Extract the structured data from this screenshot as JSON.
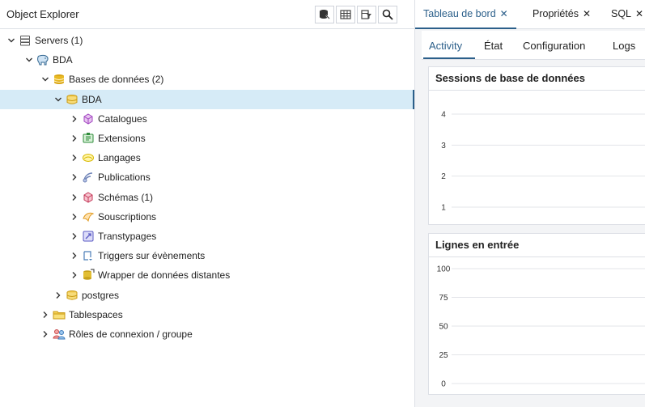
{
  "explorer": {
    "title": "Object Explorer",
    "toolbar": [
      {
        "name": "query-tool-icon"
      },
      {
        "name": "view-data-icon"
      },
      {
        "name": "filtered-rows-icon"
      },
      {
        "name": "search-icon"
      }
    ]
  },
  "tree": [
    {
      "label": "Servers (1)",
      "icon": "servers-icon",
      "chevron": "expanded",
      "depth": 0
    },
    {
      "label": "BDA",
      "icon": "elephant-icon",
      "chevron": "expanded",
      "depth": 1
    },
    {
      "label": "Bases de données (2)",
      "icon": "databases-icon",
      "chevron": "expanded",
      "depth": 2
    },
    {
      "label": "BDA",
      "icon": "database-icon",
      "chevron": "expanded",
      "depth": 3,
      "selected": true
    },
    {
      "label": "Catalogues",
      "icon": "catalog-icon",
      "chevron": "collapsed",
      "depth": 4
    },
    {
      "label": "Extensions",
      "icon": "extension-icon",
      "chevron": "collapsed",
      "depth": 4
    },
    {
      "label": "Langages",
      "icon": "language-icon",
      "chevron": "collapsed",
      "depth": 4
    },
    {
      "label": "Publications",
      "icon": "publication-icon",
      "chevron": "collapsed",
      "depth": 4
    },
    {
      "label": "Schémas (1)",
      "icon": "schema-icon",
      "chevron": "collapsed",
      "depth": 4
    },
    {
      "label": "Souscriptions",
      "icon": "subscription-icon",
      "chevron": "collapsed",
      "depth": 4
    },
    {
      "label": "Transtypages",
      "icon": "cast-icon",
      "chevron": "collapsed",
      "depth": 4
    },
    {
      "label": "Triggers sur évènements",
      "icon": "event-trigger-icon",
      "chevron": "collapsed",
      "depth": 4
    },
    {
      "label": "Wrapper de données distantes",
      "icon": "fdw-icon",
      "chevron": "collapsed",
      "depth": 4
    },
    {
      "label": "postgres",
      "icon": "database-icon",
      "chevron": "collapsed",
      "depth": 3
    },
    {
      "label": "Tablespaces",
      "icon": "tablespace-icon",
      "chevron": "collapsed",
      "depth": 2
    },
    {
      "label": "Rôles de connexion / groupe",
      "icon": "roles-icon",
      "chevron": "collapsed",
      "depth": 2
    }
  ],
  "panel_tabs": [
    {
      "label": "Tableau de bord",
      "active": true
    },
    {
      "label": "Propriétés",
      "active": false
    },
    {
      "label": "SQL",
      "active": false
    }
  ],
  "tab_close_glyph": "✕",
  "sub_tabs": [
    {
      "label": "Activity",
      "active": true
    },
    {
      "label": "État",
      "active": false
    },
    {
      "label": "Configuration",
      "active": false
    },
    {
      "label": "Logs",
      "active": false
    }
  ],
  "colors": {
    "accent": "#2b5f8a",
    "selected_row": "#d6ebf7",
    "gridline": "#e3e5e9"
  },
  "chart_data": [
    {
      "type": "line",
      "title": "Sessions de base de données",
      "yticks": [
        4,
        3,
        2,
        1
      ],
      "ylim": [
        1,
        4
      ],
      "series": []
    },
    {
      "type": "line",
      "title": "Lignes en entrée",
      "yticks": [
        100,
        75,
        50,
        25,
        0
      ],
      "ylim": [
        0,
        100
      ],
      "series": []
    }
  ]
}
